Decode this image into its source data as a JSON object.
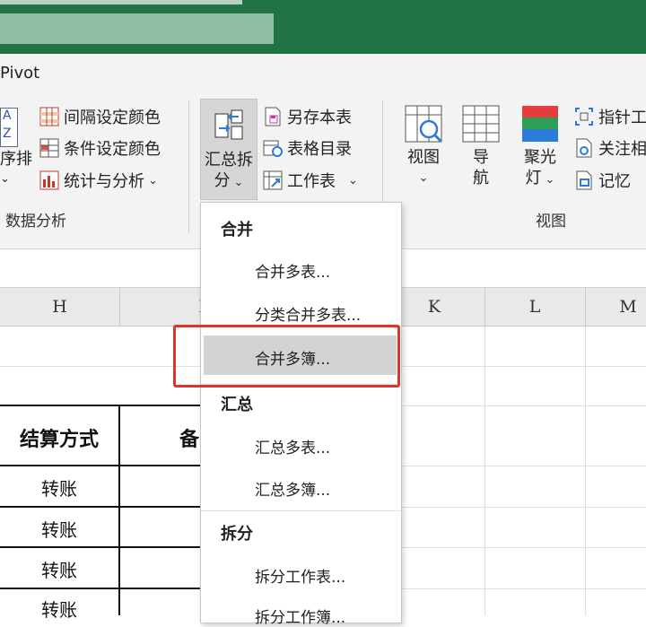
{
  "ribbon": {
    "tab_label": "Pivot",
    "data_group": {
      "label": "数据分析",
      "sort_partial_top": "A",
      "sort_partial_mid": "Z",
      "sort_partial_label": "序排",
      "items": [
        "间隔设定颜色",
        "条件设定颜色",
        "统计与分析"
      ]
    },
    "merge_button": {
      "line1": "汇总拆",
      "line2": "分"
    },
    "sheet_items": [
      "另存本表",
      "表格目录",
      "工作表"
    ],
    "view_group": {
      "label": "视图",
      "view_btn": "视图",
      "nav_btn_line1": "导",
      "nav_btn_line2": "航",
      "spotlight_line1": "聚光",
      "spotlight_line2": "灯",
      "side_items": [
        "指针工",
        "关注相",
        "记忆"
      ]
    }
  },
  "columns": [
    "H",
    "I",
    "K",
    "L",
    "M"
  ],
  "table": {
    "header": [
      "结算方式",
      "备"
    ],
    "rows": [
      "转账",
      "转账",
      "转账",
      "转账"
    ]
  },
  "menu": {
    "sections": [
      {
        "header": "合并",
        "items": [
          "合并多表...",
          "分类合并多表...",
          "合并多簿..."
        ]
      },
      {
        "header": "汇总",
        "items": [
          "汇总多表...",
          "汇总多簿..."
        ]
      },
      {
        "header": "拆分",
        "items": [
          "拆分工作表...",
          "拆分工作簿..."
        ]
      }
    ],
    "highlighted": "合并多簿..."
  },
  "colors": {
    "excel_green": "#217346",
    "highlight": "#e0342a"
  }
}
